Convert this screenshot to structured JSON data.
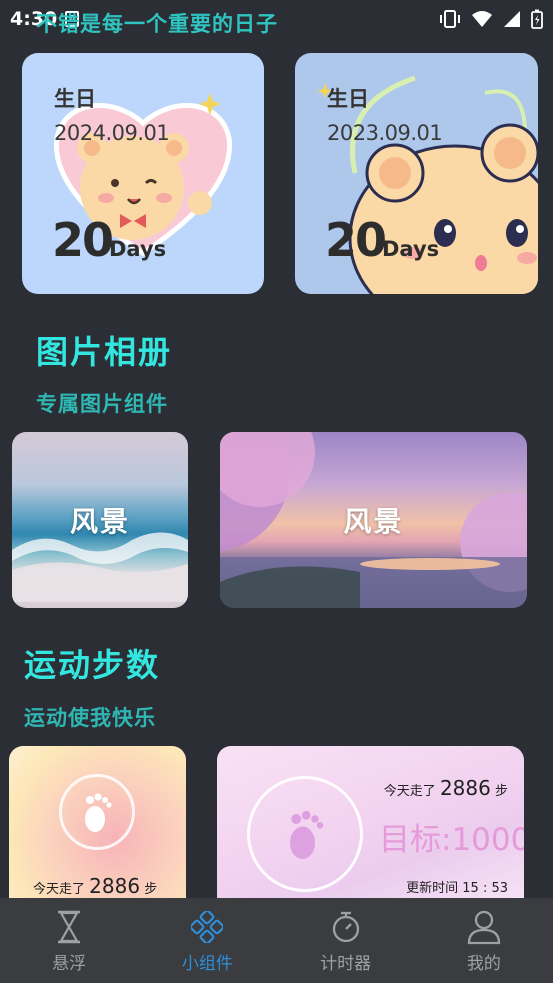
{
  "status_bar": {
    "time": "4:30",
    "app_icon_letter": "A"
  },
  "top_title": "不错是每一个重要的日子",
  "birthday_cards": [
    {
      "label": "生日",
      "date": "2024.09.01",
      "count": "20",
      "unit": "Days"
    },
    {
      "label": "生日",
      "date": "2023.09.01",
      "count": "20",
      "unit": "Days"
    }
  ],
  "album": {
    "title": "图片相册",
    "subtitle": "专属图片组件",
    "items": [
      "风景",
      "风景"
    ]
  },
  "steps": {
    "title": "运动步数",
    "subtitle": "运动使我快乐",
    "card1": {
      "prefix": "今天走了",
      "count": "2886",
      "suffix": "步"
    },
    "card2": {
      "prefix": "今天走了",
      "count": "2886",
      "suffix": "步",
      "goal": "目标:1000",
      "update_label": "更新时间",
      "update_time": "15 : 53"
    }
  },
  "nav": {
    "items": [
      {
        "label": "悬浮",
        "icon": "hourglass-icon"
      },
      {
        "label": "小组件",
        "icon": "widget-icon"
      },
      {
        "label": "计时器",
        "icon": "stopwatch-icon"
      },
      {
        "label": "我的",
        "icon": "person-icon"
      }
    ],
    "active_index": 1,
    "active_color": "#2f8ed8"
  },
  "colors": {
    "background": "#2b2e34",
    "accent": "#33e6e0"
  }
}
